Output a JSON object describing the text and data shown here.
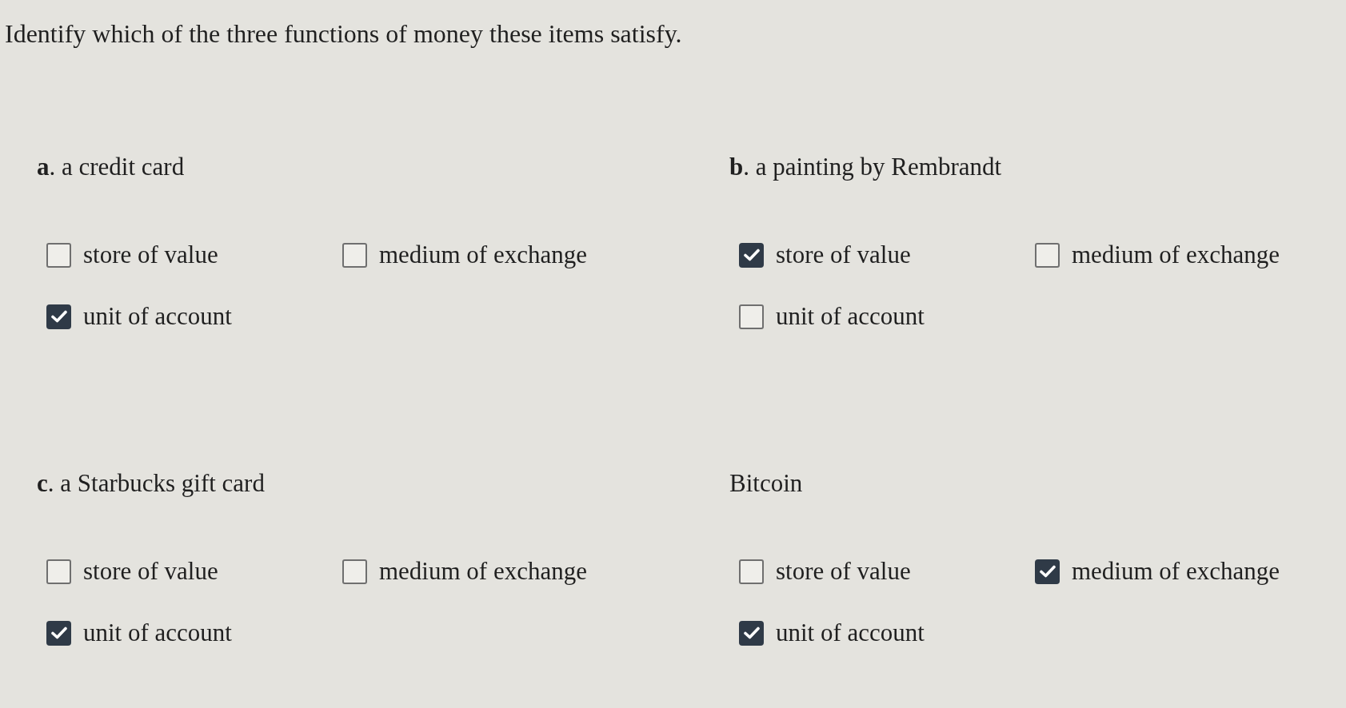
{
  "instruction": "Identify which of the three functions of money these items satisfy.",
  "items": [
    {
      "label": "**a**. a credit card",
      "options": [
        {
          "label": "store of value",
          "checked": false
        },
        {
          "label": "medium of exchange",
          "checked": false
        },
        {
          "label": "unit of account",
          "checked": true
        }
      ]
    },
    {
      "label": "**b**. a painting by Rembrandt",
      "options": [
        {
          "label": "store of value",
          "checked": true
        },
        {
          "label": "medium of exchange",
          "checked": false
        },
        {
          "label": "unit of account",
          "checked": false
        }
      ]
    },
    {
      "label": "**c**. a Starbucks gift card",
      "options": [
        {
          "label": "store of value",
          "checked": false
        },
        {
          "label": "medium of exchange",
          "checked": false
        },
        {
          "label": "unit of account",
          "checked": true
        }
      ]
    },
    {
      "label": "Bitcoin",
      "options": [
        {
          "label": "store of value",
          "checked": false
        },
        {
          "label": "medium of exchange",
          "checked": true
        },
        {
          "label": "unit of account",
          "checked": true
        }
      ]
    }
  ]
}
